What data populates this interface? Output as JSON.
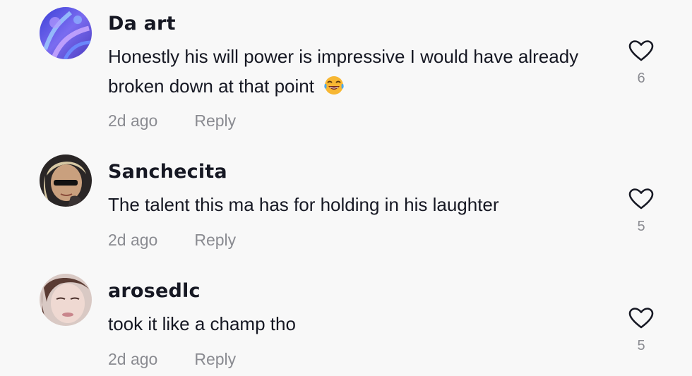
{
  "comments": [
    {
      "username": "Da art",
      "text": "Honestly his will power is impressive I would have already broken down at that point",
      "emoji": "😂",
      "timestamp": "2d ago",
      "reply_label": "Reply",
      "likes": "6"
    },
    {
      "username": "Sanchecita",
      "text": "The talent this ma has for holding in his laughter",
      "timestamp": "2d ago",
      "reply_label": "Reply",
      "likes": "5"
    },
    {
      "username": "arosedlc",
      "text": "took it like a champ tho",
      "timestamp": "2d ago",
      "reply_label": "Reply",
      "likes": "5"
    }
  ],
  "icons": {
    "like": "heart-outline-icon",
    "emoji": "face-with-tears-of-joy"
  },
  "colors": {
    "background": "#f8f8f8",
    "text": "#161823",
    "muted": "#8a8b91"
  }
}
